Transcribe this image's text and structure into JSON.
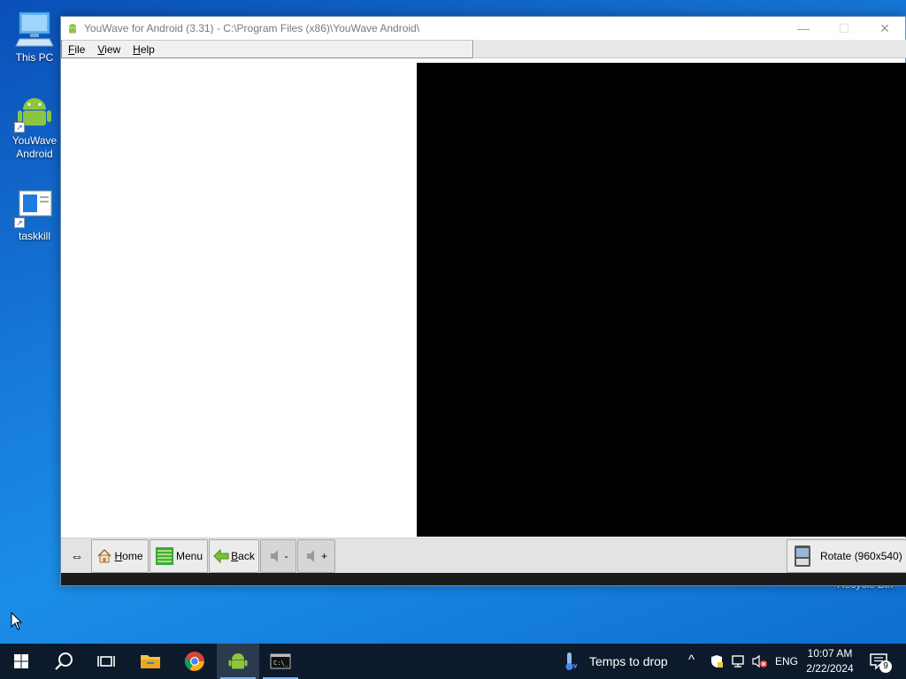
{
  "desktop": {
    "icons": [
      {
        "label": "This PC"
      },
      {
        "label": "YouWave\nAndroid"
      },
      {
        "label": "taskkill"
      }
    ],
    "recycle_bin_label": "Recycle Bin"
  },
  "window": {
    "title": "YouWave for Android (3.31) - C:\\Program Files (x86)\\YouWave Android\\",
    "controls": {
      "minimize": "—",
      "maximize": "☐",
      "close": "✕"
    },
    "menu": {
      "file": {
        "u": "F",
        "rest": "ile"
      },
      "view": {
        "u": "V",
        "rest": "iew"
      },
      "help": {
        "u": "H",
        "rest": "elp"
      }
    },
    "toolbar": {
      "expand_glyph": "⇔",
      "home": {
        "u": "H",
        "rest": "ome"
      },
      "menu": "Menu",
      "back": {
        "u": "B",
        "rest": "ack"
      },
      "vol_down": "-",
      "vol_up": "+",
      "rotate": "Rotate (960x540)"
    },
    "colors": {
      "screen": "#000000",
      "pane": "#ffffff"
    }
  },
  "taskbar": {
    "weather": "Temps to drop",
    "language": "ENG",
    "time": "10:07 AM",
    "date": "2/22/2024",
    "notification_count": "9"
  }
}
